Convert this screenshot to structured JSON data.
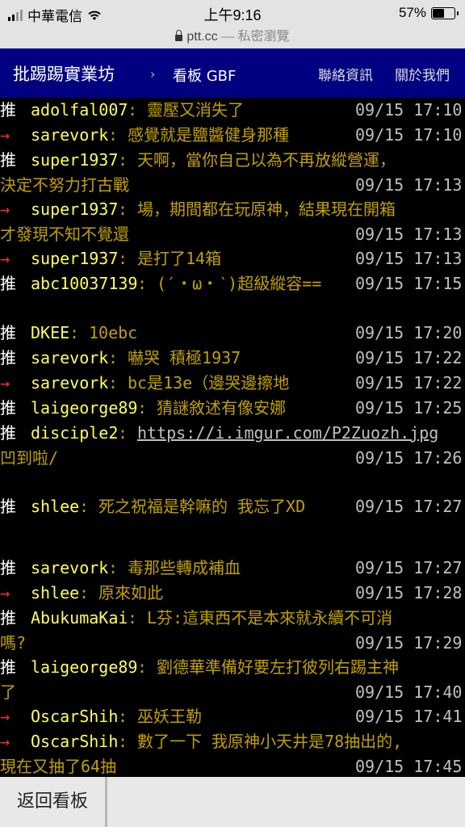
{
  "status_bar": {
    "carrier": "中華電信",
    "time": "上午9:16",
    "battery": "57%",
    "battery_level": 0.57
  },
  "browser": {
    "domain": "ptt.cc",
    "private_label": "— 私密瀏覽"
  },
  "header": {
    "brand": "批踢踢實業坊",
    "chevron": "›",
    "board": "看板 GBF",
    "links": [
      "聯絡資訊",
      "關於我們"
    ]
  },
  "comments": [
    {
      "tag": "推",
      "user": "adolfal007",
      "msg": "靈壓又消失了",
      "time": "09/15 17:10"
    },
    {
      "tag": "→",
      "user": "sarevork",
      "msg": "感覺就是鹽醬健身那種",
      "time": "09/15 17:10"
    },
    {
      "tag": "推",
      "user": "super1937",
      "msg": "天啊，當你自己以為不再放縱營運，",
      "cont": "決定不努力打古戰",
      "time": "09/15 17:13"
    },
    {
      "tag": "→",
      "user": "super1937",
      "msg": "場，期間都在玩原神，結果現在開箱",
      "cont": "才發現不知不覺還",
      "time": "09/15 17:13"
    },
    {
      "tag": "→",
      "user": "super1937",
      "msg": "是打了14箱",
      "time": "09/15 17:13"
    },
    {
      "tag": "推",
      "user": "abc10037139",
      "msg": "(′・ω・‵)超級縱容==",
      "time": "09/15 17:15"
    },
    {
      "tag": "推",
      "user": "DKEE",
      "msg": "10ebc",
      "time": "09/15 17:20"
    },
    {
      "tag": "推",
      "user": "sarevork",
      "msg": "嚇哭 積極1937",
      "time": "09/15 17:22"
    },
    {
      "tag": "→",
      "user": "sarevork",
      "msg": "bc是13e（邊哭邊擦地",
      "time": "09/15 17:22"
    },
    {
      "tag": "推",
      "user": "laigeorge89",
      "msg": "猜謎敘述有像安娜",
      "time": "09/15 17:25"
    },
    {
      "tag": "推",
      "user": "disciple2",
      "msg": "https://i.imgur.com/P2Zuozh.jpg",
      "cont": "凹到啦/",
      "time": "09/15 17:26"
    },
    {
      "tag": "推",
      "user": "shlee",
      "msg": "死之祝福是幹嘛的 我忘了XD",
      "time": "09/15 17:27"
    },
    {
      "tag": "推",
      "user": "sarevork",
      "msg": "毒那些轉成補血",
      "time": "09/15 17:27"
    },
    {
      "tag": "→",
      "user": "shlee",
      "msg": "原來如此",
      "time": "09/15 17:28"
    },
    {
      "tag": "推",
      "user": "AbukumaKai",
      "msg": "L芬:這東西不是本來就永續不可消",
      "cont": "嗎?",
      "time": "09/15 17:29"
    },
    {
      "tag": "推",
      "user": "laigeorge89",
      "msg": "劉德華準備好要左打彼列右踢主神",
      "cont": "了",
      "time": "09/15 17:40"
    },
    {
      "tag": "→",
      "user": "OscarShih",
      "msg": "巫妖王勒",
      "time": "09/15 17:41"
    },
    {
      "tag": "→",
      "user": "OscarShih",
      "msg": "數了一下 我原神小天井是78抽出的,",
      "cont": "現在又抽了64抽",
      "time": "09/15 17:45"
    }
  ],
  "toolbar": {
    "back_label": "返回看板"
  }
}
